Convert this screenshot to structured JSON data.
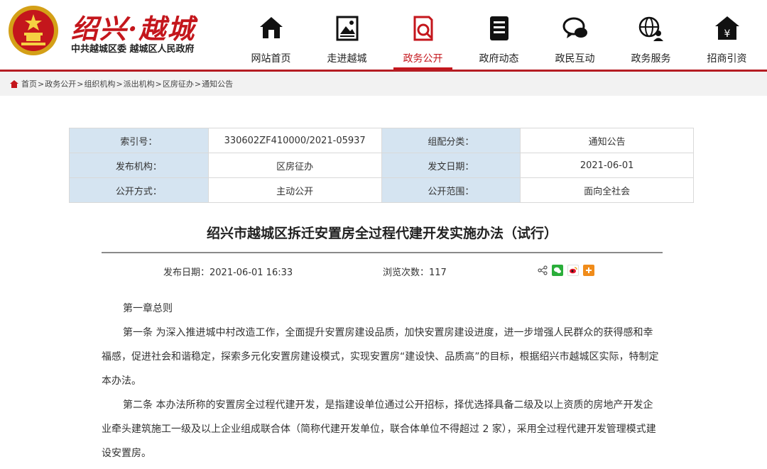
{
  "header": {
    "site_name": "绍兴·越城",
    "site_sub": "中共越城区委 越城区人民政府"
  },
  "nav": [
    {
      "label": "网站首页",
      "icon": "home-icon"
    },
    {
      "label": "走进越城",
      "icon": "picture-icon"
    },
    {
      "label": "政务公开",
      "icon": "document-search-icon",
      "active": true
    },
    {
      "label": "政府动态",
      "icon": "news-icon"
    },
    {
      "label": "政民互动",
      "icon": "chat-icon"
    },
    {
      "label": "政务服务",
      "icon": "globe-user-icon"
    },
    {
      "label": "招商引资",
      "icon": "yen-house-icon"
    }
  ],
  "breadcrumb": [
    "首页",
    "政务公开",
    "组织机构",
    "派出机构",
    "区房征办",
    "通知公告"
  ],
  "info": {
    "index_label": "索引号：",
    "index_value": "330602ZF410000/2021-05937",
    "category_label": "组配分类：",
    "category_value": "通知公告",
    "org_label": "发布机构：",
    "org_value": "区房征办",
    "date_label": "发文日期：",
    "date_value": "2021-06-01",
    "mode_label": "公开方式：",
    "mode_value": "主动公开",
    "scope_label": "公开范围：",
    "scope_value": "面向全社会"
  },
  "article": {
    "title": "绍兴市越城区拆迁安置房全过程代建开发实施办法（试行）",
    "publish_date": "发布日期：2021-06-01 16:33",
    "views": "浏览次数：117",
    "paragraphs": [
      "第一章总则",
      "第一条 为深入推进城中村改造工作，全面提升安置房建设品质，加快安置房建设进度，进一步增强人民群众的获得感和幸福感，促进社会和谐稳定，探索多元化安置房建设模式，实现安置房“建设快、品质高”的目标，根据绍兴市越城区实际，特制定本办法。",
      "第二条  本办法所称的安置房全过程代建开发，是指建设单位通过公开招标，择优选择具备二级及以上资质的房地产开发企业牵头建筑施工一级及以上企业组成联合体（简称代建开发单位，联合体单位不得超过 2 家），采用全过程代建开发管理模式建设安置房。"
    ]
  },
  "colors": {
    "brand_red": "#c4161c",
    "table_key_bg": "#d5e4f1"
  }
}
